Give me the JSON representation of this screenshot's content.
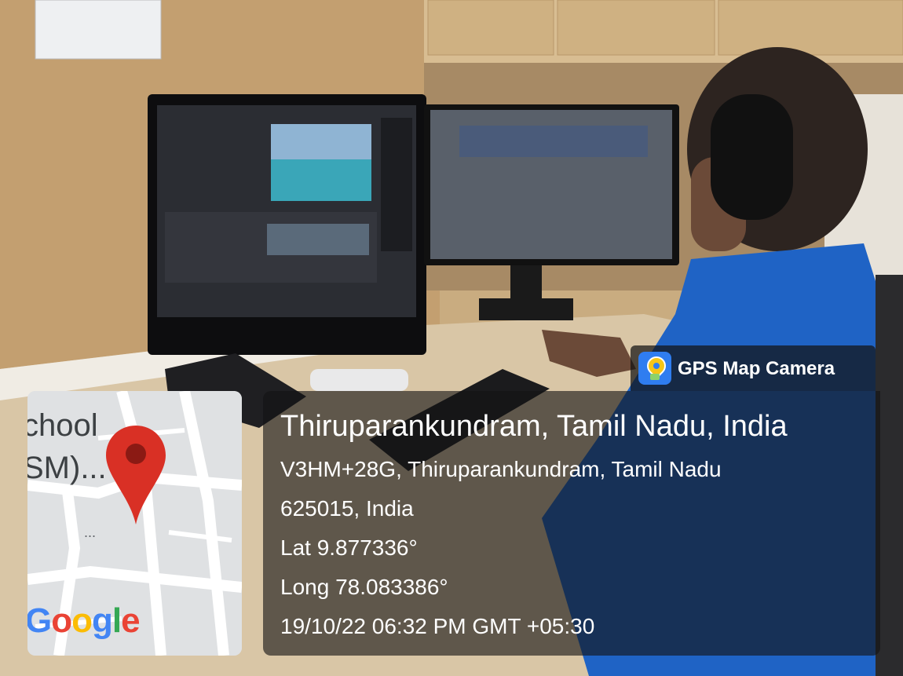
{
  "badge": {
    "icon": "gps-map-camera-icon",
    "label": "GPS Map Camera"
  },
  "location": {
    "title": "Thiruparankundram, Tamil Nadu, India",
    "address_line1": "V3HM+28G, Thiruparankundram, Tamil Nadu",
    "address_line2": "625015, India",
    "lat": "Lat 9.877336°",
    "long": "Long 78.083386°",
    "datetime": "19/10/22 06:32 PM GMT +05:30"
  },
  "map": {
    "label_fragment_1": "chool",
    "label_fragment_2": "SM)...",
    "dots": "...",
    "pin_icon": "map-pin-icon",
    "logo": "Google",
    "pin_color": "#d93025"
  }
}
